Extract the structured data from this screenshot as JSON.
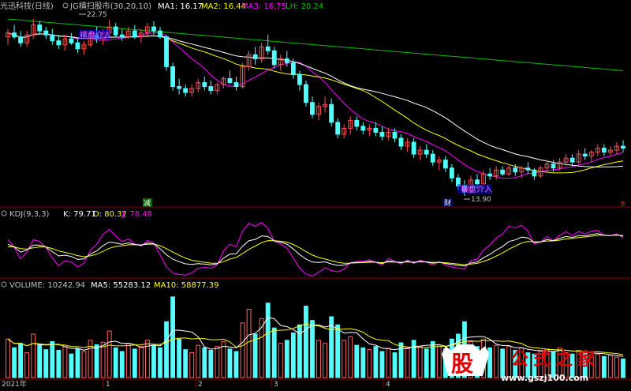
{
  "colors": {
    "bg": "#000000",
    "up": "#ff5050",
    "down": "#54fcfc",
    "ma1": "#ffffff",
    "ma2": "#ffff00",
    "ma3": "#ff00ff",
    "lh": "#00c000",
    "grid": "#8b0000",
    "label": "#c0c0c0",
    "signal": "#0000ff",
    "volume_up": "#ff6464"
  },
  "price_panel": {
    "header": {
      "title": "光迅科技(日线)",
      "indicator": "JG横扫股市(30,20,10)",
      "ma1": "MA1: 16.17",
      "ma2": "MA2: 16.44",
      "ma3": "MA3: 16.75",
      "lh": "LH: 20.24"
    },
    "annotations": {
      "high_label": "22.75",
      "low_label": "13.90",
      "buy_signal_1": "横盘介入",
      "buy_signal_2": "横盘介入",
      "sell_mark": "减",
      "finance_mark": "财",
      "end_mark": "±"
    }
  },
  "kdj_panel": {
    "header": {
      "name": "KDJ(9,3,3)",
      "k": "K: 79.71",
      "d": "D: 80.32",
      "j": "J: 78.48"
    }
  },
  "volume_panel": {
    "header": {
      "name": "VOLUME: 10242.94",
      "ma5": "MA5: 55283.12",
      "ma10": "MA10: 58877.39"
    }
  },
  "x_axis": {
    "labels": [
      "2021年",
      "1",
      "2",
      "3",
      "4"
    ]
  },
  "watermark": {
    "logo": "股",
    "name": "公式之家",
    "url": "www.gszj100.com"
  },
  "chart_data": {
    "type": "candlestick",
    "series_ohlc": [
      [
        21.9,
        22.3,
        21.5,
        22.1
      ],
      [
        22.1,
        22.5,
        21.8,
        21.9
      ],
      [
        21.9,
        22.2,
        21.4,
        21.6
      ],
      [
        21.6,
        22.2,
        21.4,
        22.0
      ],
      [
        22.0,
        22.8,
        21.8,
        22.5
      ],
      [
        22.5,
        22.7,
        22.0,
        22.2
      ],
      [
        22.2,
        22.4,
        21.8,
        22.0
      ],
      [
        22.0,
        22.3,
        21.5,
        21.7
      ],
      [
        21.7,
        22.0,
        21.3,
        21.5
      ],
      [
        21.5,
        22.0,
        21.2,
        21.8
      ],
      [
        21.8,
        22.1,
        21.5,
        21.6
      ],
      [
        21.6,
        21.8,
        21.1,
        21.3
      ],
      [
        21.3,
        21.7,
        21.0,
        21.5
      ],
      [
        21.5,
        22.2,
        21.4,
        22.0
      ],
      [
        22.0,
        22.4,
        21.6,
        21.8
      ],
      [
        21.8,
        22.3,
        21.5,
        22.1
      ],
      [
        22.1,
        22.75,
        21.9,
        22.4
      ],
      [
        22.4,
        22.6,
        21.9,
        22.0
      ],
      [
        22.0,
        22.3,
        21.7,
        21.9
      ],
      [
        21.9,
        22.4,
        21.8,
        22.2
      ],
      [
        22.2,
        22.5,
        21.8,
        21.9
      ],
      [
        21.9,
        22.3,
        21.6,
        22.1
      ],
      [
        22.1,
        22.6,
        21.9,
        22.4
      ],
      [
        22.4,
        22.7,
        22.0,
        22.2
      ],
      [
        22.2,
        22.4,
        21.8,
        21.9
      ],
      [
        21.9,
        22.0,
        20.2,
        20.4
      ],
      [
        20.4,
        20.6,
        19.2,
        19.4
      ],
      [
        19.4,
        19.8,
        19.0,
        19.3
      ],
      [
        19.3,
        19.5,
        18.9,
        19.1
      ],
      [
        19.1,
        19.5,
        18.9,
        19.3
      ],
      [
        19.3,
        19.8,
        19.1,
        19.6
      ],
      [
        19.6,
        19.9,
        19.2,
        19.4
      ],
      [
        19.4,
        19.7,
        19.0,
        19.2
      ],
      [
        19.2,
        19.6,
        19.0,
        19.5
      ],
      [
        19.5,
        19.9,
        19.3,
        19.8
      ],
      [
        19.8,
        20.2,
        19.5,
        19.6
      ],
      [
        19.6,
        19.9,
        19.2,
        19.4
      ],
      [
        19.4,
        20.6,
        19.3,
        20.4
      ],
      [
        20.4,
        21.2,
        20.2,
        21.0
      ],
      [
        21.0,
        21.4,
        20.5,
        20.8
      ],
      [
        20.8,
        21.6,
        20.6,
        21.4
      ],
      [
        21.4,
        22.0,
        21.0,
        21.2
      ],
      [
        21.2,
        21.4,
        20.3,
        20.5
      ],
      [
        20.5,
        21.0,
        20.2,
        20.8
      ],
      [
        20.8,
        21.2,
        20.4,
        20.6
      ],
      [
        20.6,
        20.8,
        19.8,
        20.0
      ],
      [
        20.0,
        20.2,
        19.2,
        19.5
      ],
      [
        19.5,
        19.7,
        18.4,
        18.6
      ],
      [
        18.6,
        18.9,
        17.8,
        18.0
      ],
      [
        18.0,
        18.6,
        17.7,
        18.4
      ],
      [
        18.4,
        18.9,
        18.1,
        18.5
      ],
      [
        18.5,
        18.8,
        17.4,
        17.6
      ],
      [
        17.6,
        17.8,
        16.8,
        17.0
      ],
      [
        17.0,
        17.5,
        16.8,
        17.3
      ],
      [
        17.3,
        17.9,
        17.0,
        17.7
      ],
      [
        17.7,
        17.9,
        17.2,
        17.4
      ],
      [
        17.4,
        17.6,
        17.0,
        17.2
      ],
      [
        17.2,
        17.5,
        16.9,
        17.3
      ],
      [
        17.3,
        17.6,
        16.9,
        17.1
      ],
      [
        17.1,
        17.4,
        16.7,
        16.9
      ],
      [
        16.9,
        17.3,
        16.7,
        17.1
      ],
      [
        17.1,
        17.3,
        16.6,
        16.8
      ],
      [
        16.8,
        17.0,
        16.2,
        16.4
      ],
      [
        16.4,
        16.8,
        16.1,
        16.6
      ],
      [
        16.6,
        16.8,
        15.8,
        16.0
      ],
      [
        16.0,
        16.4,
        15.7,
        16.2
      ],
      [
        16.2,
        16.5,
        15.8,
        16.0
      ],
      [
        16.0,
        16.2,
        15.4,
        15.6
      ],
      [
        15.6,
        15.9,
        15.2,
        15.7
      ],
      [
        15.7,
        15.9,
        15.1,
        15.3
      ],
      [
        15.3,
        15.5,
        14.6,
        14.8
      ],
      [
        14.8,
        15.0,
        14.2,
        14.4
      ],
      [
        14.4,
        14.7,
        13.9,
        14.1
      ],
      [
        14.1,
        14.9,
        14.0,
        14.7
      ],
      [
        14.7,
        15.0,
        14.3,
        14.5
      ],
      [
        14.5,
        15.2,
        14.4,
        15.0
      ],
      [
        15.0,
        15.3,
        14.7,
        14.9
      ],
      [
        14.9,
        15.4,
        14.7,
        15.2
      ],
      [
        15.2,
        15.4,
        14.9,
        15.0
      ],
      [
        15.0,
        15.5,
        14.9,
        15.3
      ],
      [
        15.3,
        15.5,
        14.9,
        15.1
      ],
      [
        15.1,
        15.4,
        14.8,
        15.3
      ],
      [
        15.3,
        15.6,
        15.0,
        15.2
      ],
      [
        15.2,
        15.3,
        14.7,
        14.9
      ],
      [
        14.9,
        15.4,
        14.8,
        15.3
      ],
      [
        15.3,
        15.7,
        15.1,
        15.5
      ],
      [
        15.5,
        15.7,
        15.1,
        15.3
      ],
      [
        15.3,
        15.8,
        15.2,
        15.6
      ],
      [
        15.6,
        16.0,
        15.4,
        15.8
      ],
      [
        15.8,
        16.0,
        15.4,
        15.6
      ],
      [
        15.6,
        16.2,
        15.5,
        16.0
      ],
      [
        16.0,
        16.3,
        15.7,
        15.9
      ],
      [
        15.9,
        16.2,
        15.6,
        16.1
      ],
      [
        16.1,
        16.5,
        15.9,
        16.3
      ],
      [
        16.3,
        16.5,
        15.9,
        16.1
      ],
      [
        16.1,
        16.4,
        15.9,
        16.2
      ],
      [
        16.2,
        16.6,
        16.0,
        16.4
      ],
      [
        16.4,
        16.7,
        16.1,
        16.3
      ]
    ],
    "price_range": [
      13.5,
      23.2
    ],
    "kdj_range": [
      -10,
      110
    ],
    "volume": [
      62,
      48,
      55,
      40,
      70,
      52,
      45,
      58,
      44,
      50,
      38,
      46,
      42,
      60,
      53,
      57,
      75,
      48,
      42,
      55,
      46,
      50,
      60,
      52,
      48,
      90,
      130,
      62,
      45,
      40,
      52,
      48,
      44,
      50,
      58,
      46,
      42,
      88,
      110,
      70,
      95,
      120,
      80,
      55,
      60,
      72,
      85,
      115,
      92,
      60,
      55,
      98,
      85,
      60,
      66,
      52,
      48,
      45,
      50,
      42,
      47,
      40,
      56,
      48,
      60,
      50,
      46,
      58,
      52,
      46,
      62,
      70,
      90,
      58,
      50,
      62,
      48,
      52,
      46,
      50,
      44,
      48,
      40,
      38,
      44,
      46,
      42,
      48,
      40,
      38,
      44,
      40,
      36,
      38,
      34,
      36,
      33,
      30
    ],
    "volume_max": 140
  }
}
